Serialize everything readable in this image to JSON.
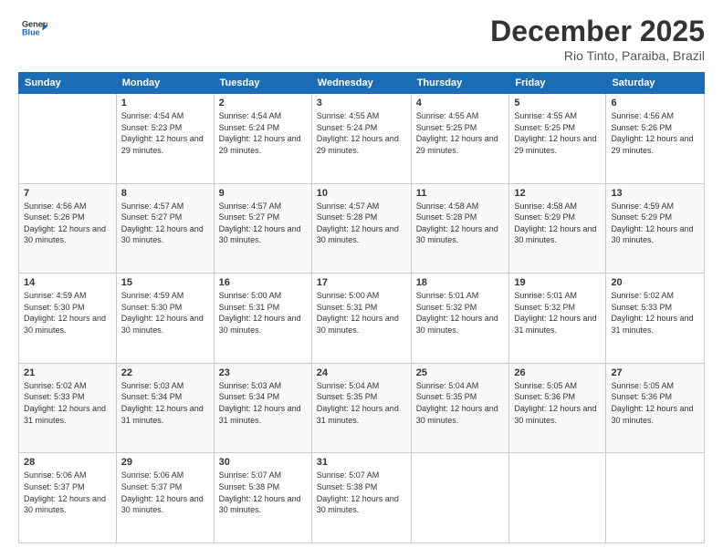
{
  "logo": {
    "line1": "General",
    "line2": "Blue"
  },
  "header": {
    "month_year": "December 2025",
    "location": "Rio Tinto, Paraiba, Brazil"
  },
  "days_of_week": [
    "Sunday",
    "Monday",
    "Tuesday",
    "Wednesday",
    "Thursday",
    "Friday",
    "Saturday"
  ],
  "weeks": [
    [
      {
        "day": "",
        "sunrise": "",
        "sunset": "",
        "daylight": ""
      },
      {
        "day": "1",
        "sunrise": "Sunrise: 4:54 AM",
        "sunset": "Sunset: 5:23 PM",
        "daylight": "Daylight: 12 hours and 29 minutes."
      },
      {
        "day": "2",
        "sunrise": "Sunrise: 4:54 AM",
        "sunset": "Sunset: 5:24 PM",
        "daylight": "Daylight: 12 hours and 29 minutes."
      },
      {
        "day": "3",
        "sunrise": "Sunrise: 4:55 AM",
        "sunset": "Sunset: 5:24 PM",
        "daylight": "Daylight: 12 hours and 29 minutes."
      },
      {
        "day": "4",
        "sunrise": "Sunrise: 4:55 AM",
        "sunset": "Sunset: 5:25 PM",
        "daylight": "Daylight: 12 hours and 29 minutes."
      },
      {
        "day": "5",
        "sunrise": "Sunrise: 4:55 AM",
        "sunset": "Sunset: 5:25 PM",
        "daylight": "Daylight: 12 hours and 29 minutes."
      },
      {
        "day": "6",
        "sunrise": "Sunrise: 4:56 AM",
        "sunset": "Sunset: 5:26 PM",
        "daylight": "Daylight: 12 hours and 29 minutes."
      }
    ],
    [
      {
        "day": "7",
        "sunrise": "Sunrise: 4:56 AM",
        "sunset": "Sunset: 5:26 PM",
        "daylight": "Daylight: 12 hours and 30 minutes."
      },
      {
        "day": "8",
        "sunrise": "Sunrise: 4:57 AM",
        "sunset": "Sunset: 5:27 PM",
        "daylight": "Daylight: 12 hours and 30 minutes."
      },
      {
        "day": "9",
        "sunrise": "Sunrise: 4:57 AM",
        "sunset": "Sunset: 5:27 PM",
        "daylight": "Daylight: 12 hours and 30 minutes."
      },
      {
        "day": "10",
        "sunrise": "Sunrise: 4:57 AM",
        "sunset": "Sunset: 5:28 PM",
        "daylight": "Daylight: 12 hours and 30 minutes."
      },
      {
        "day": "11",
        "sunrise": "Sunrise: 4:58 AM",
        "sunset": "Sunset: 5:28 PM",
        "daylight": "Daylight: 12 hours and 30 minutes."
      },
      {
        "day": "12",
        "sunrise": "Sunrise: 4:58 AM",
        "sunset": "Sunset: 5:29 PM",
        "daylight": "Daylight: 12 hours and 30 minutes."
      },
      {
        "day": "13",
        "sunrise": "Sunrise: 4:59 AM",
        "sunset": "Sunset: 5:29 PM",
        "daylight": "Daylight: 12 hours and 30 minutes."
      }
    ],
    [
      {
        "day": "14",
        "sunrise": "Sunrise: 4:59 AM",
        "sunset": "Sunset: 5:30 PM",
        "daylight": "Daylight: 12 hours and 30 minutes."
      },
      {
        "day": "15",
        "sunrise": "Sunrise: 4:59 AM",
        "sunset": "Sunset: 5:30 PM",
        "daylight": "Daylight: 12 hours and 30 minutes."
      },
      {
        "day": "16",
        "sunrise": "Sunrise: 5:00 AM",
        "sunset": "Sunset: 5:31 PM",
        "daylight": "Daylight: 12 hours and 30 minutes."
      },
      {
        "day": "17",
        "sunrise": "Sunrise: 5:00 AM",
        "sunset": "Sunset: 5:31 PM",
        "daylight": "Daylight: 12 hours and 30 minutes."
      },
      {
        "day": "18",
        "sunrise": "Sunrise: 5:01 AM",
        "sunset": "Sunset: 5:32 PM",
        "daylight": "Daylight: 12 hours and 30 minutes."
      },
      {
        "day": "19",
        "sunrise": "Sunrise: 5:01 AM",
        "sunset": "Sunset: 5:32 PM",
        "daylight": "Daylight: 12 hours and 31 minutes."
      },
      {
        "day": "20",
        "sunrise": "Sunrise: 5:02 AM",
        "sunset": "Sunset: 5:33 PM",
        "daylight": "Daylight: 12 hours and 31 minutes."
      }
    ],
    [
      {
        "day": "21",
        "sunrise": "Sunrise: 5:02 AM",
        "sunset": "Sunset: 5:33 PM",
        "daylight": "Daylight: 12 hours and 31 minutes."
      },
      {
        "day": "22",
        "sunrise": "Sunrise: 5:03 AM",
        "sunset": "Sunset: 5:34 PM",
        "daylight": "Daylight: 12 hours and 31 minutes."
      },
      {
        "day": "23",
        "sunrise": "Sunrise: 5:03 AM",
        "sunset": "Sunset: 5:34 PM",
        "daylight": "Daylight: 12 hours and 31 minutes."
      },
      {
        "day": "24",
        "sunrise": "Sunrise: 5:04 AM",
        "sunset": "Sunset: 5:35 PM",
        "daylight": "Daylight: 12 hours and 31 minutes."
      },
      {
        "day": "25",
        "sunrise": "Sunrise: 5:04 AM",
        "sunset": "Sunset: 5:35 PM",
        "daylight": "Daylight: 12 hours and 30 minutes."
      },
      {
        "day": "26",
        "sunrise": "Sunrise: 5:05 AM",
        "sunset": "Sunset: 5:36 PM",
        "daylight": "Daylight: 12 hours and 30 minutes."
      },
      {
        "day": "27",
        "sunrise": "Sunrise: 5:05 AM",
        "sunset": "Sunset: 5:36 PM",
        "daylight": "Daylight: 12 hours and 30 minutes."
      }
    ],
    [
      {
        "day": "28",
        "sunrise": "Sunrise: 5:06 AM",
        "sunset": "Sunset: 5:37 PM",
        "daylight": "Daylight: 12 hours and 30 minutes."
      },
      {
        "day": "29",
        "sunrise": "Sunrise: 5:06 AM",
        "sunset": "Sunset: 5:37 PM",
        "daylight": "Daylight: 12 hours and 30 minutes."
      },
      {
        "day": "30",
        "sunrise": "Sunrise: 5:07 AM",
        "sunset": "Sunset: 5:38 PM",
        "daylight": "Daylight: 12 hours and 30 minutes."
      },
      {
        "day": "31",
        "sunrise": "Sunrise: 5:07 AM",
        "sunset": "Sunset: 5:38 PM",
        "daylight": "Daylight: 12 hours and 30 minutes."
      },
      {
        "day": "",
        "sunrise": "",
        "sunset": "",
        "daylight": ""
      },
      {
        "day": "",
        "sunrise": "",
        "sunset": "",
        "daylight": ""
      },
      {
        "day": "",
        "sunrise": "",
        "sunset": "",
        "daylight": ""
      }
    ]
  ]
}
